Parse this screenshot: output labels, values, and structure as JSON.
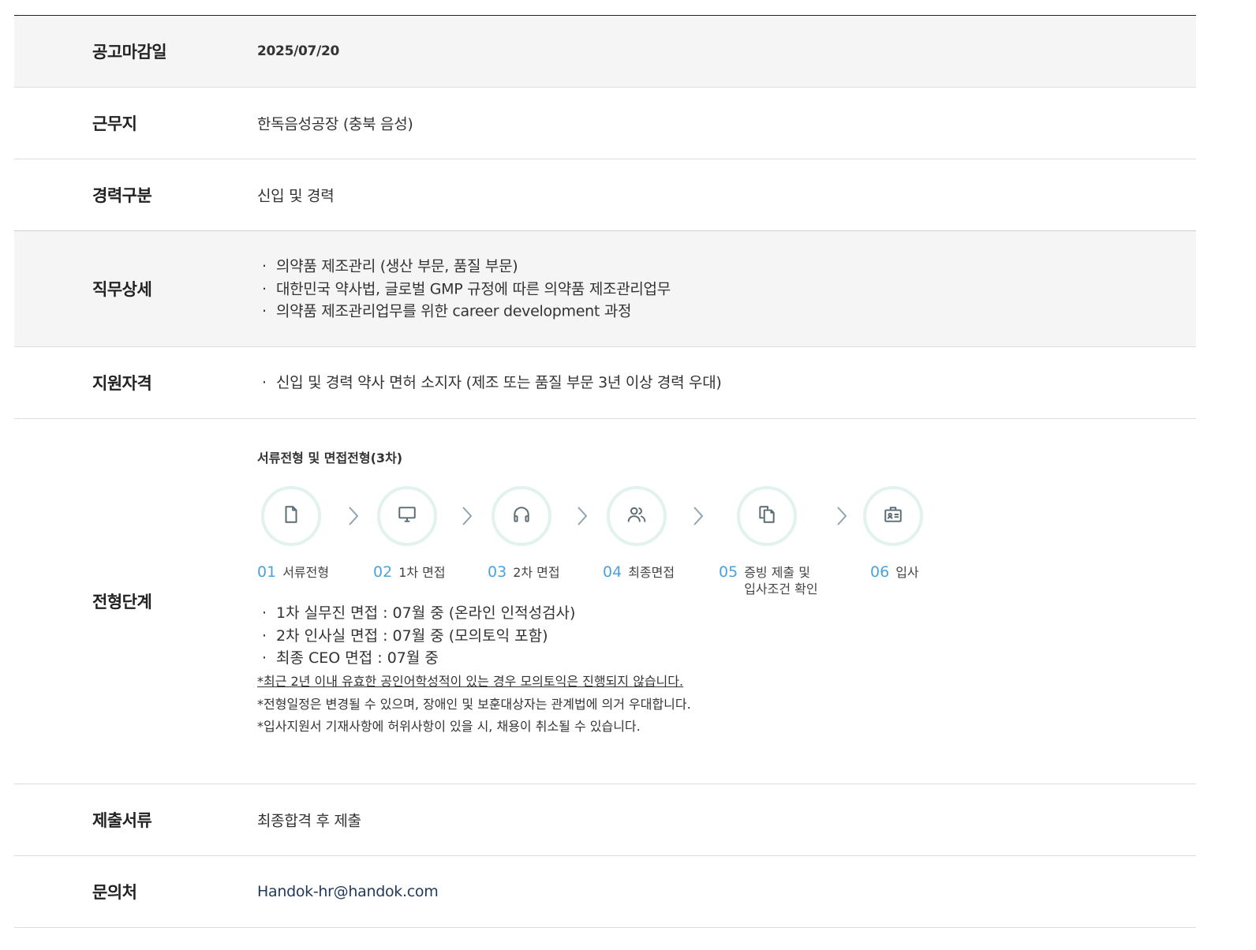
{
  "rows": {
    "deadline": {
      "label": "공고마감일",
      "value": "2025/07/20"
    },
    "location": {
      "label": "근무지",
      "value": "한독음성공장 (충북 음성)"
    },
    "career": {
      "label": "경력구분",
      "value": "신입 및 경력"
    },
    "duties": {
      "label": "직무상세",
      "items": [
        "의약품 제조관리 (생산 부문, 품질 부문)",
        "대한민국 약사법, 글로벌 GMP 규정에 따른 의약품 제조관리업무",
        "의약품 제조관리업무를 위한 career development 과정"
      ]
    },
    "qualification": {
      "label": "지원자격",
      "items": [
        "신입 및 경력 약사 면허 소지자 (제조 또는 품질 부문 3년 이상 경력 우대)"
      ]
    },
    "process": {
      "label": "전형단계",
      "title": "서류전형 및 면접전형(3차)",
      "steps": [
        {
          "num": "01",
          "text": "서류전형",
          "icon": "document-icon"
        },
        {
          "num": "02",
          "text": "1차 면접",
          "icon": "monitor-icon"
        },
        {
          "num": "03",
          "text": "2차 면접",
          "icon": "headset-icon"
        },
        {
          "num": "04",
          "text": "최종면접",
          "icon": "people-icon"
        },
        {
          "num": "05",
          "text": "증빙 제출 및",
          "text2": "입사조건 확인",
          "icon": "copy-documents-icon"
        },
        {
          "num": "06",
          "text": "입사",
          "icon": "id-card-icon"
        }
      ],
      "items": [
        "1차 실무진 면접 : 07월 중 (온라인 인적성검사)",
        "2차 인사실 면접 : 07월 중 (모의토익 포함)",
        "최종 CEO 면접 : 07월 중"
      ],
      "notes": [
        "*최근 2년 이내 유효한 공인어학성적이 있는 경우 모의토익은 진행되지 않습니다.",
        "*전형일정은 변경될 수 있으며, 장애인 및 보훈대상자는 관계법에 의거 우대합니다.",
        "*입사지원서 기재사항에 허위사항이 있을 시, 채용이 취소될 수 있습니다."
      ]
    },
    "documents": {
      "label": "제출서류",
      "value": "최종합격 후 제출"
    },
    "contact": {
      "label": "문의처",
      "value": "Handok-hr@handok.com"
    }
  },
  "colors": {
    "accent_number": "#4aa3df",
    "circle_border": "#e1f2ef",
    "icon_stroke": "#5a6b73",
    "row_gray": "#f5f5f5"
  }
}
